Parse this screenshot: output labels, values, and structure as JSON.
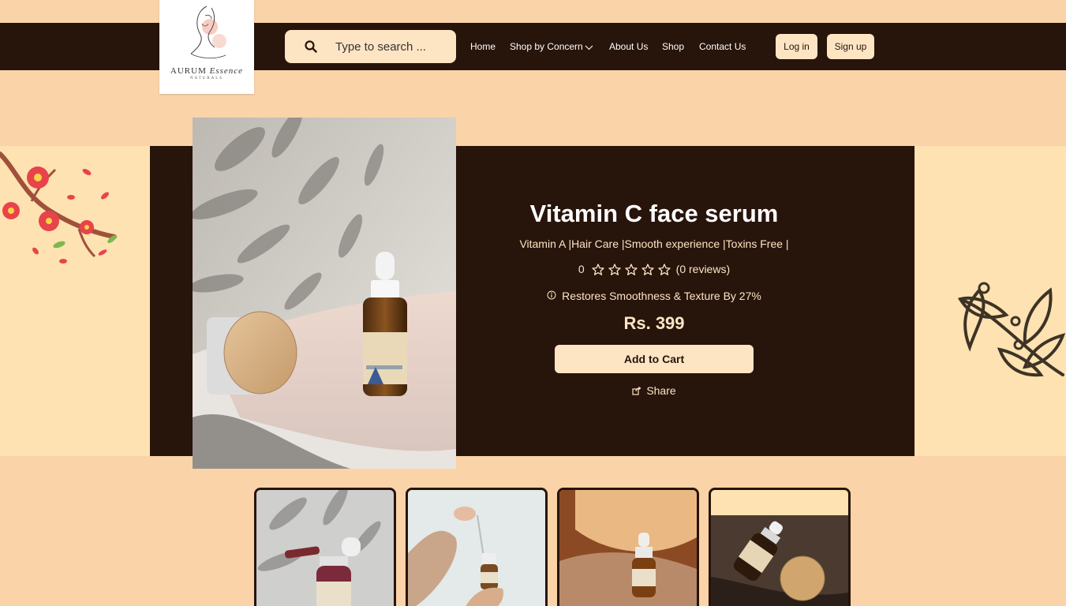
{
  "brand": {
    "name_main": "AURUM",
    "name_script": "Essence",
    "name_sub": "NATURALS"
  },
  "search": {
    "placeholder": "Type to search ..."
  },
  "nav": {
    "home": "Home",
    "shop_by_concern": "Shop by Concern",
    "about": "About Us",
    "shop": "Shop",
    "contact": "Contact Us"
  },
  "auth": {
    "login": "Log in",
    "signup": "Sign up"
  },
  "product": {
    "title": "Vitamin C face serum",
    "tags": "Vitamin A  |Hair Care  |Smooth experience  |Toxins Free  |",
    "rating_value": "0",
    "star_count": 5,
    "reviews": "(0 reviews)",
    "benefit": "Restores Smoothness & Texture By 27%",
    "price": "Rs. 399",
    "add_to_cart": "Add to Cart",
    "share": "Share"
  },
  "colors": {
    "page_bg": "#fad3a9",
    "dark_brown": "#27140b",
    "cream": "#fde5c4",
    "side_panel": "#fee2b1"
  },
  "icons": [
    "search-icon",
    "chevron-down-icon",
    "star-icon",
    "info-icon",
    "share-icon",
    "cherry-blossom-branch",
    "leaf-branch"
  ]
}
